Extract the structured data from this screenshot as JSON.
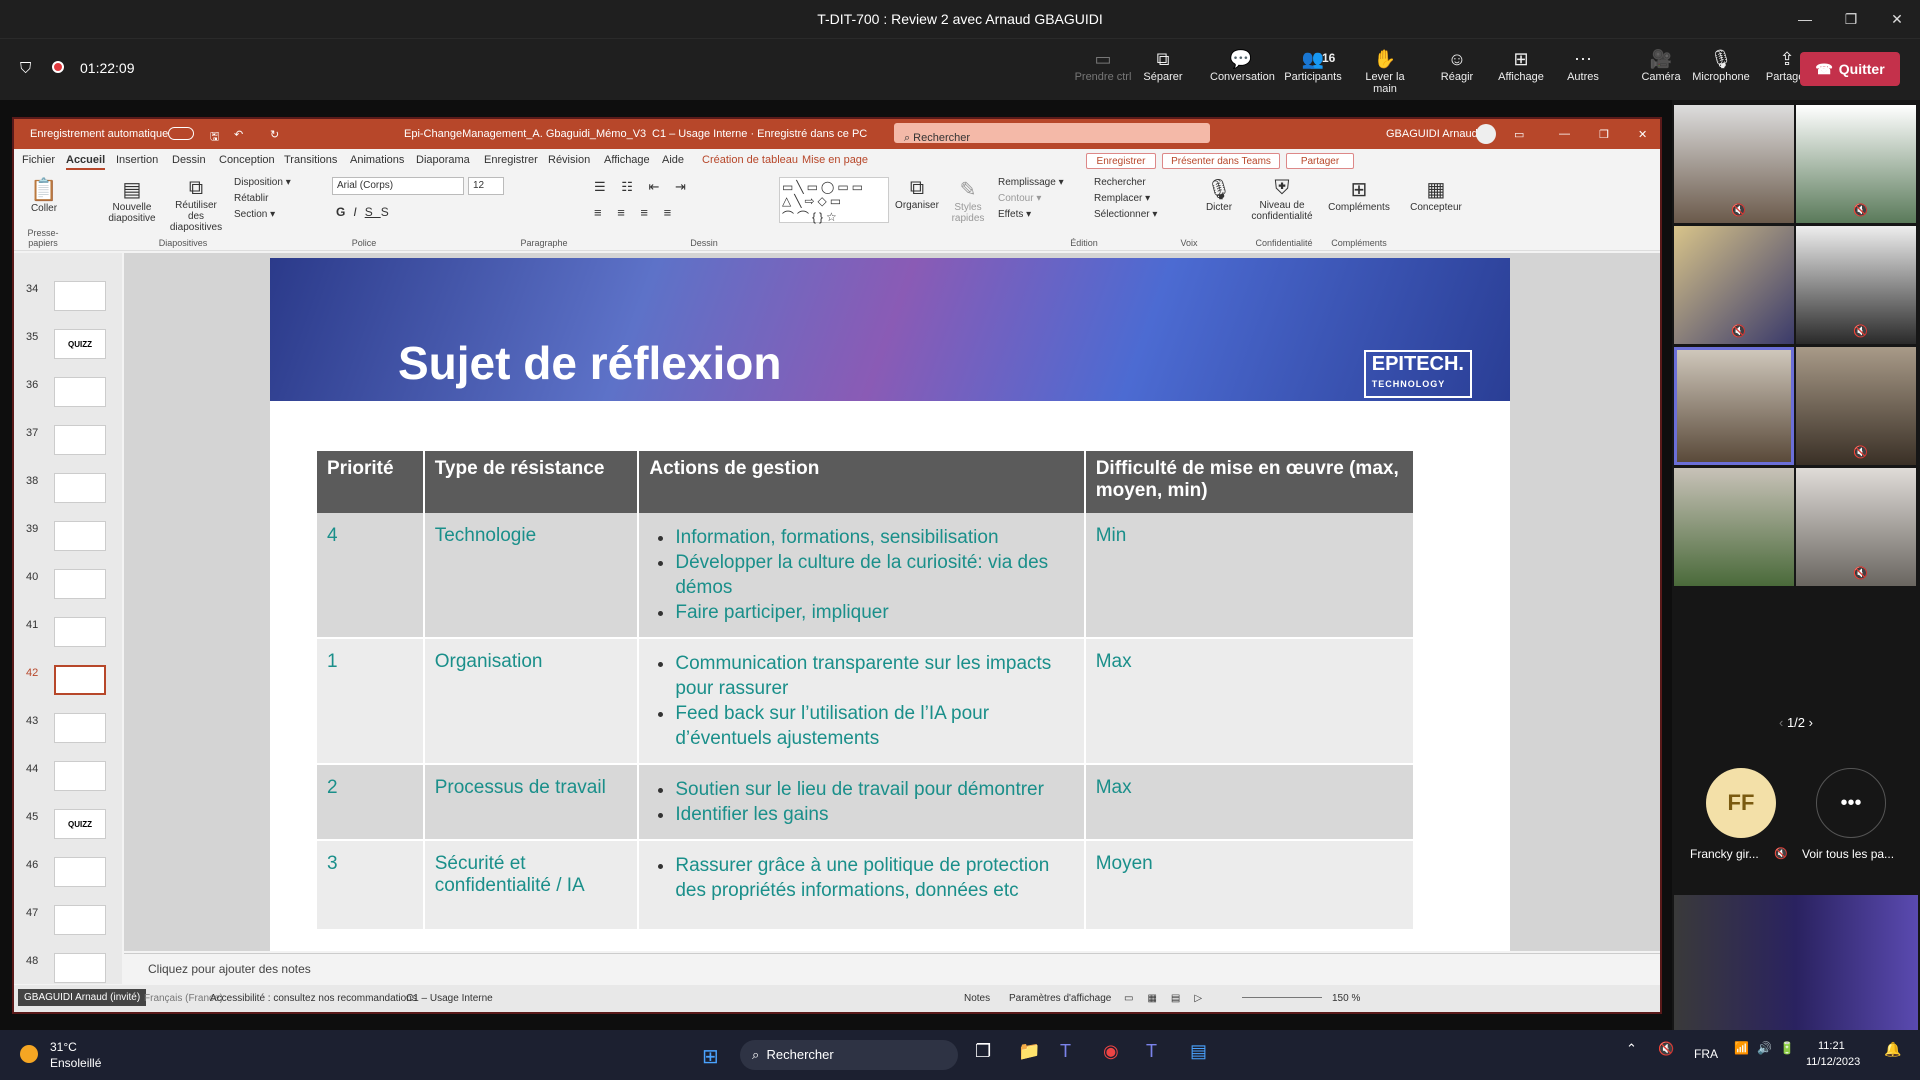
{
  "teams": {
    "title": "T-DIT-700 : Review 2 avec Arnaud GBAGUIDI",
    "timer": "01:22:09",
    "buttons": [
      {
        "label": "Prendre ctrl",
        "icon": "control-icon"
      },
      {
        "label": "Séparer",
        "icon": "split-icon"
      },
      {
        "label": "Conversation",
        "icon": "chat-icon"
      },
      {
        "label": "Participants",
        "icon": "people-icon",
        "badge": "16"
      },
      {
        "label": "Lever la main",
        "icon": "hand-icon"
      },
      {
        "label": "Réagir",
        "icon": "smile-icon"
      },
      {
        "label": "Affichage",
        "icon": "grid-icon"
      },
      {
        "label": "Autres",
        "icon": "more-icon"
      },
      {
        "label": "Caméra",
        "icon": "camera-icon"
      },
      {
        "label": "Microphone",
        "icon": "mic-off-icon"
      },
      {
        "label": "Partager",
        "icon": "share-icon"
      }
    ],
    "leave": "Quitter",
    "page": "1/2",
    "avatar_initials": "FF",
    "participant_name": "Francky gir...",
    "see_all": "Voir tous les pa..."
  },
  "ppt": {
    "autosave": "Enregistrement automatique",
    "filename": "Epi-ChangeManagement_A. Gbaguidi_Mémo_V3",
    "sensitivity": "C1 – Usage Interne · Enregistré dans ce PC",
    "search": "Rechercher",
    "user": "GBAGUIDI Arnaud",
    "tabs": [
      "Fichier",
      "Accueil",
      "Insertion",
      "Dessin",
      "Conception",
      "Transitions",
      "Animations",
      "Diaporama",
      "Enregistrer",
      "Révision",
      "Affichage",
      "Aide",
      "Création de tableau",
      "Mise en page"
    ],
    "actions": [
      "Enregistrer",
      "Présenter dans Teams",
      "Partager"
    ],
    "ribbon": {
      "coller": "Coller",
      "nouvelle": "Nouvelle diapositive",
      "reutiliser": "Réutiliser des diapositives",
      "disposition": "Disposition",
      "retablir": "Rétablir",
      "section": "Section",
      "font": "Arial (Corps)",
      "size": "12",
      "organiser": "Organiser",
      "styles": "Styles rapides",
      "remplissage": "Remplissage",
      "contour": "Contour",
      "effets": "Effets",
      "rechercher": "Rechercher",
      "remplacer": "Remplacer",
      "selectionner": "Sélectionner",
      "dicter": "Dicter",
      "niveau": "Niveau de confidentialité",
      "complements": "Compléments",
      "concepteur": "Concepteur",
      "groups": [
        "Presse-papiers",
        "Diapositives",
        "Police",
        "Paragraphe",
        "Dessin",
        "Édition",
        "Voix",
        "Confidentialité",
        "Compléments"
      ]
    },
    "thumbs": [
      {
        "n": "34",
        "t": ""
      },
      {
        "n": "35",
        "t": "QUIZZ"
      },
      {
        "n": "36",
        "t": ""
      },
      {
        "n": "37",
        "t": ""
      },
      {
        "n": "38",
        "t": ""
      },
      {
        "n": "39",
        "t": ""
      },
      {
        "n": "40",
        "t": ""
      },
      {
        "n": "41",
        "t": ""
      },
      {
        "n": "42",
        "t": ""
      },
      {
        "n": "43",
        "t": ""
      },
      {
        "n": "44",
        "t": ""
      },
      {
        "n": "45",
        "t": "QUIZZ"
      },
      {
        "n": "46",
        "t": ""
      },
      {
        "n": "47",
        "t": ""
      },
      {
        "n": "48",
        "t": ""
      }
    ],
    "slide": {
      "title": "Sujet de réflexion",
      "logo": "EPITECH.",
      "logo_sub": "TECHNOLOGY",
      "headers": [
        "Priorité",
        "Type de résistance",
        "Actions de gestion",
        "Difficulté de mise en œuvre (max, moyen, min)"
      ],
      "rows": [
        {
          "p": "4",
          "type": "Technologie",
          "actions": [
            "Information, formations, sensibilisation",
            "Développer la culture de la curiosité: via des démos",
            "Faire participer, impliquer"
          ],
          "diff": "Min"
        },
        {
          "p": "1",
          "type": "Organisation",
          "actions": [
            "Communication transparente sur les impacts pour rassurer",
            "Feed back sur l’utilisation de l’IA pour d’éventuels ajustements"
          ],
          "diff": "Max"
        },
        {
          "p": "2",
          "type": "Processus de travail",
          "actions": [
            "Soutien sur le lieu de travail pour démontrer",
            "Identifier les gains"
          ],
          "diff": "Max"
        },
        {
          "p": "3",
          "type": "Sécurité et confidentialité / IA",
          "actions": [
            "Rassurer grâce à une politique de protection des propriétés informations, données etc"
          ],
          "diff": "Moyen"
        }
      ]
    },
    "notes": "Cliquez pour ajouter des notes",
    "status": {
      "presenter": "GBAGUIDI Arnaud (invité)",
      "lang": "Français (France)",
      "access": "Accessibilité : consultez nos recommandations",
      "label": "C1 – Usage Interne",
      "notes": "Notes",
      "display": "Paramètres d'affichage",
      "zoom": "150 %"
    }
  },
  "taskbar": {
    "temp": "31°C",
    "weather": "Ensoleillé",
    "search": "Rechercher",
    "lang": "FRA",
    "time": "11:21",
    "date": "11/12/2023"
  }
}
